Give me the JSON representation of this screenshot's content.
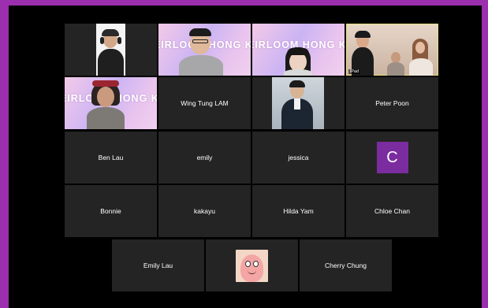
{
  "window": {
    "frame_color": "#9b2fae",
    "active_speaker_color": "#e8e07a"
  },
  "participants": [
    {
      "name": "",
      "type": "video",
      "scene": "headphones-man-white-bg"
    },
    {
      "name": "",
      "type": "video",
      "scene": "eirloom-banner-man",
      "banner_text": "EIRLOOM HONG KONG"
    },
    {
      "name": "",
      "type": "video",
      "scene": "eirloom-banner-woman",
      "banner_text": "EIRLOOM HONG KON"
    },
    {
      "name": "",
      "type": "video",
      "scene": "group-of-three",
      "device_tag": "iPad",
      "active": true
    },
    {
      "name": "",
      "type": "video",
      "scene": "eirloom-banner-woman-2",
      "banner_text": "EIRLOOM HONG KONG"
    },
    {
      "name": "Wing Tung LAM",
      "type": "name"
    },
    {
      "name": "",
      "type": "photo",
      "scene": "man-in-suit"
    },
    {
      "name": "Peter Poon",
      "type": "name"
    },
    {
      "name": "Ben Lau",
      "type": "name"
    },
    {
      "name": "emily",
      "type": "name"
    },
    {
      "name": "jessica",
      "type": "name"
    },
    {
      "name": "",
      "type": "avatar",
      "initial": "C",
      "avatar_color": "#7b2d9f"
    },
    {
      "name": "Bonnie",
      "type": "name"
    },
    {
      "name": "kakayu",
      "type": "name"
    },
    {
      "name": "Hilda Yam",
      "type": "name"
    },
    {
      "name": "Chloe Chan",
      "type": "name"
    },
    {
      "name": "Emily Lau",
      "type": "name"
    },
    {
      "name": "",
      "type": "photo",
      "scene": "patrick-star-avatar"
    },
    {
      "name": "Cherry Chung",
      "type": "name"
    }
  ]
}
